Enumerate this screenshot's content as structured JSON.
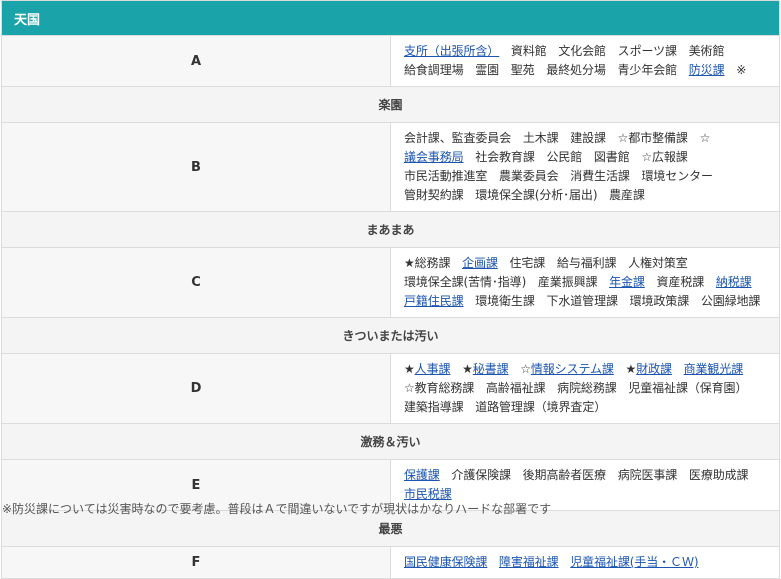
{
  "colors": {
    "header_bg": "#1aa3a8",
    "link": "#1b55b0",
    "section_bg": "#f4f4f4"
  },
  "tiers": [
    {
      "heading": "天国",
      "grade": "A",
      "items": [
        {
          "text": "支所（出張所含）",
          "link": true
        },
        {
          "text": "資料館"
        },
        {
          "text": "文化会館"
        },
        {
          "text": "スポーツ課"
        },
        {
          "text": "美術館"
        },
        {
          "text": "給食調理場"
        },
        {
          "text": "霊園"
        },
        {
          "text": "聖苑"
        },
        {
          "text": "最終処分場"
        },
        {
          "text": "青少年会館"
        },
        {
          "text": "防災課",
          "link": true
        },
        {
          "text": "※"
        }
      ]
    },
    {
      "heading": "楽園",
      "grade": "B",
      "items": [
        {
          "text": "会計課、監査委員会"
        },
        {
          "text": "土木課"
        },
        {
          "text": "建設課"
        },
        {
          "text": "☆都市整備課"
        },
        {
          "text": "☆"
        },
        {
          "text": "議会事務局",
          "link": true
        },
        {
          "text": "社会教育課"
        },
        {
          "text": "公民館"
        },
        {
          "text": "図書館"
        },
        {
          "text": "☆広報課"
        },
        {
          "text": "市民活動推進室"
        },
        {
          "text": "農業委員会"
        },
        {
          "text": "消費生活課"
        },
        {
          "text": "環境センター"
        },
        {
          "text": "管財契約課"
        },
        {
          "text": "環境保全課(分析･届出)"
        },
        {
          "text": "農産課"
        }
      ]
    },
    {
      "heading": "まあまあ",
      "grade": "C",
      "items": [
        {
          "text": "★総務課"
        },
        {
          "text": "企画課",
          "link": true
        },
        {
          "text": "住宅課"
        },
        {
          "text": "給与福利課"
        },
        {
          "text": "人権対策室"
        },
        {
          "text": "環境保全課(苦情･指導)"
        },
        {
          "text": "産業振興課"
        },
        {
          "text": "年金課",
          "link": true
        },
        {
          "text": "資産税課"
        },
        {
          "text": "納税課",
          "link": true
        },
        {
          "text": "戸籍住民課",
          "link": true
        },
        {
          "text": "環境衛生課"
        },
        {
          "text": "下水道管理課"
        },
        {
          "text": "環境政策課"
        },
        {
          "text": "公園緑地課"
        }
      ]
    },
    {
      "heading": "きついまたは汚い",
      "grade": "D",
      "items": [
        {
          "text": "★"
        },
        {
          "text": "人事課",
          "link": true
        },
        {
          "text": "★"
        },
        {
          "text": "秘書課",
          "link": true
        },
        {
          "text": "☆"
        },
        {
          "text": "情報システム課",
          "link": true
        },
        {
          "text": "★"
        },
        {
          "text": "財政課",
          "link": true
        },
        {
          "text": "商業観光課",
          "link": true
        },
        {
          "text": "☆教育総務課"
        },
        {
          "text": "高齢福祉課"
        },
        {
          "text": "病院総務課"
        },
        {
          "text": "児童福祉課（保育園）"
        },
        {
          "text": "建築指導課"
        },
        {
          "text": "道路管理課（境界査定）"
        }
      ]
    },
    {
      "heading": "激務＆汚い",
      "grade": "E",
      "items": [
        {
          "text": "保護課",
          "link": true
        },
        {
          "text": "介護保険課"
        },
        {
          "text": "後期高齢者医療"
        },
        {
          "text": "病院医事課"
        },
        {
          "text": "医療助成課"
        },
        {
          "text": "市民税課",
          "link": true
        }
      ]
    },
    {
      "heading": "最悪",
      "grade": "F",
      "items": [
        {
          "text": "国民健康保険課",
          "link": true
        },
        {
          "text": "障害福祉課",
          "link": true
        },
        {
          "text": "児童福祉課(手当・ＣＷ)",
          "link": true
        }
      ]
    }
  ],
  "footnote": "※防災課については災害時なので要考慮。普段はＡで間違いないですが現状はかなりハードな部署です"
}
